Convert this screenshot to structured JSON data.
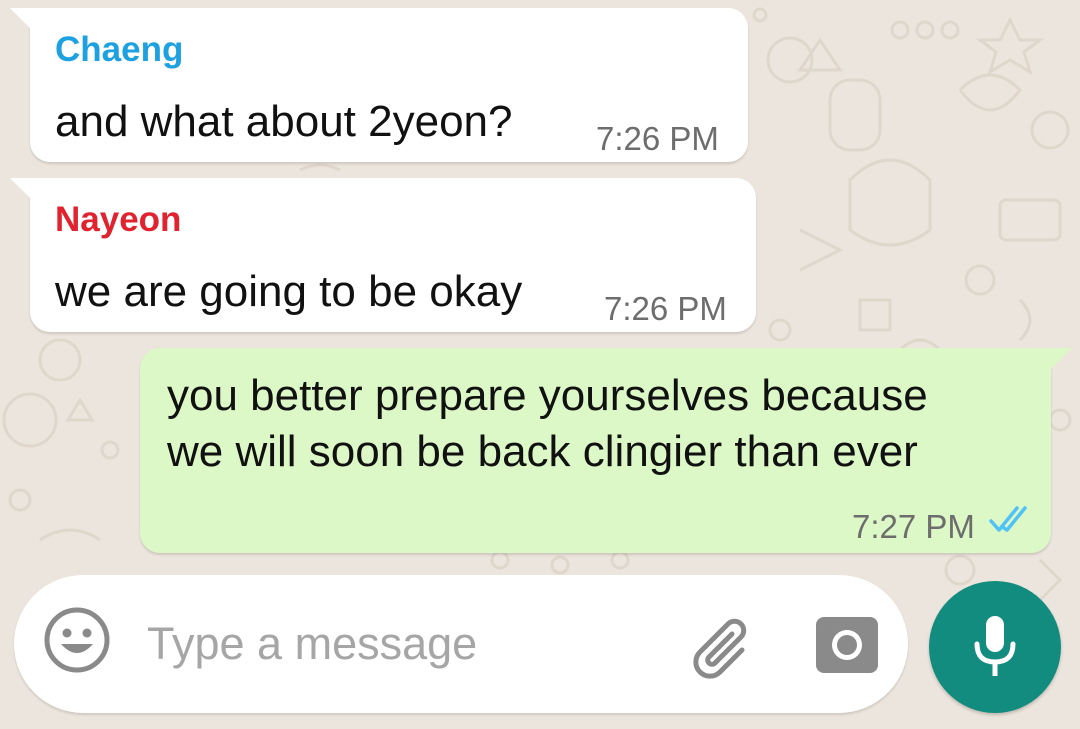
{
  "colors": {
    "background": "#ECE5DD",
    "incoming_bubble": "#FFFFFF",
    "outgoing_bubble": "#DCF8C6",
    "mic_button": "#128C7E",
    "read_ticks": "#4FC3F7"
  },
  "messages": [
    {
      "direction": "incoming",
      "sender": "Chaeng",
      "sender_color": "#1DA1E0",
      "text": "and what about 2yeon?",
      "time": "7:26 PM"
    },
    {
      "direction": "incoming",
      "sender": "Nayeon",
      "sender_color": "#E0232E",
      "text": "we are going to be okay",
      "time": "7:26 PM"
    },
    {
      "direction": "outgoing",
      "lines": [
        "you better prepare yourselves because",
        "we will soon be back clingier than ever"
      ],
      "time": "7:27 PM",
      "status_icon": "double-check-read-icon"
    }
  ],
  "composer": {
    "placeholder": "Type a message",
    "emoji_icon": "emoji-icon",
    "attach_icon": "paperclip-icon",
    "camera_icon": "camera-icon",
    "mic_icon": "microphone-icon"
  }
}
